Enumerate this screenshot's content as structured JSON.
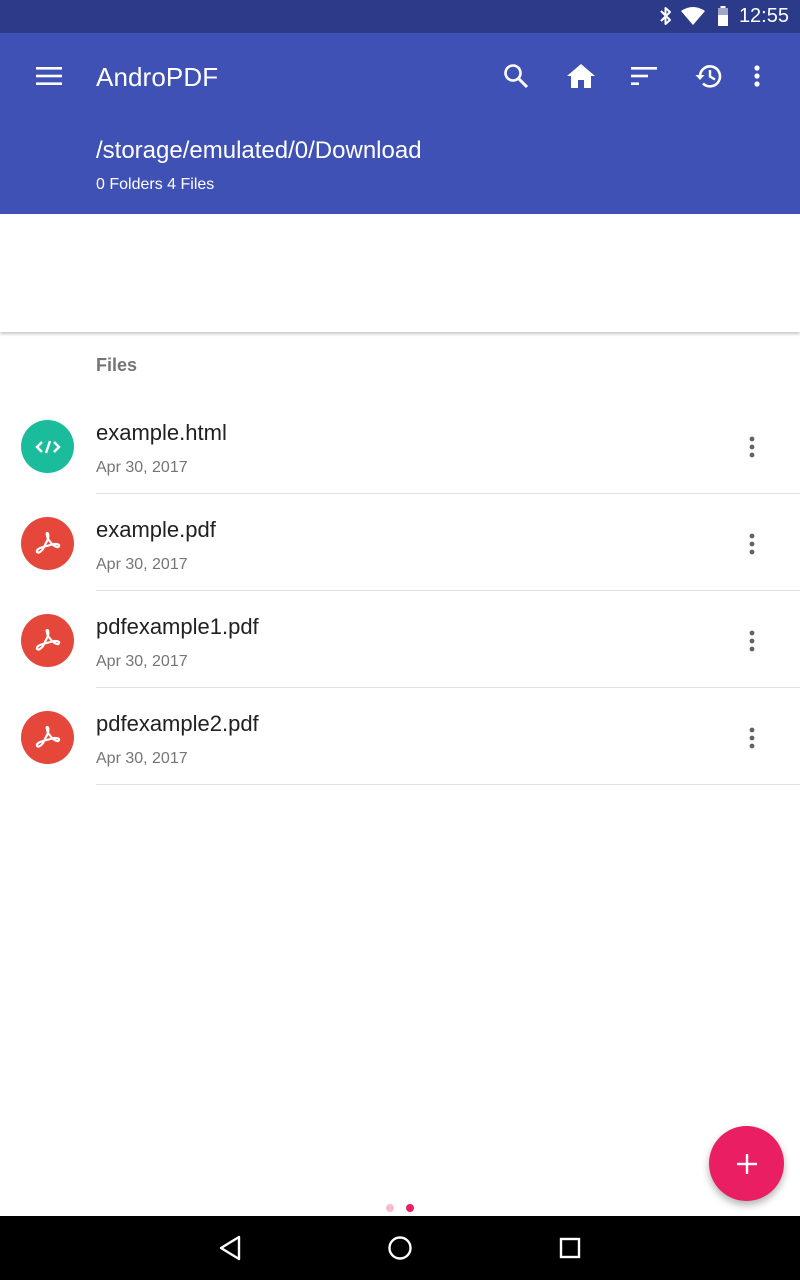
{
  "status_bar": {
    "time": "12:55",
    "icons": [
      "bluetooth-icon",
      "wifi-icon",
      "battery-icon"
    ]
  },
  "app_bar": {
    "title": "AndroPDF",
    "actions": [
      "menu-icon",
      "search-icon",
      "home-icon",
      "sort-icon",
      "history-icon",
      "more-vert-icon"
    ],
    "path": "/storage/emulated/0/Download",
    "summary": "0 Folders 4 Files"
  },
  "files_section": {
    "header": "Files",
    "items": [
      {
        "name": "example.html",
        "date": "Apr 30, 2017",
        "icon": "code-icon",
        "color": "#1abc9c"
      },
      {
        "name": "example.pdf",
        "date": "Apr 30, 2017",
        "icon": "pdf-icon",
        "color": "#e5473b"
      },
      {
        "name": "pdfexample1.pdf",
        "date": "Apr 30, 2017",
        "icon": "pdf-icon",
        "color": "#e5473b"
      },
      {
        "name": "pdfexample2.pdf",
        "date": "Apr 30, 2017",
        "icon": "pdf-icon",
        "color": "#e5473b"
      }
    ]
  },
  "pager": {
    "pages": 2,
    "active_page": 2
  },
  "fab": {
    "icon": "add-icon",
    "color": "#e91e63"
  },
  "nav_bar": {
    "buttons": [
      "back-icon",
      "home-circle-icon",
      "recents-icon"
    ]
  },
  "colors": {
    "primary": "#3f51b5",
    "primary_dark": "#2c3a8a",
    "accent": "#e91e63"
  }
}
